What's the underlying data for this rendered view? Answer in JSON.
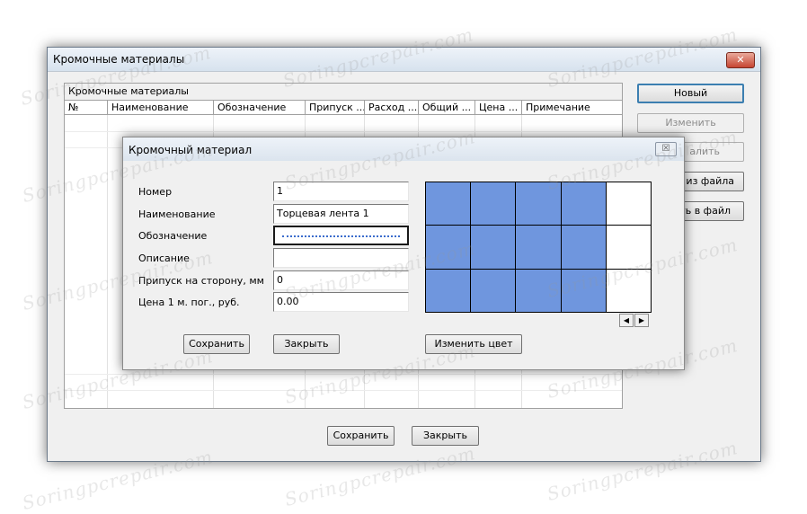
{
  "main_window": {
    "title": "Кромочные материалы",
    "close_glyph": "✕",
    "group_label": "Кромочные материалы",
    "columns": [
      "№",
      "Наименование",
      "Обозначение",
      "Припуск ...",
      "Расход ...",
      "Общий ...",
      "Цена ...",
      "Примечание"
    ],
    "buttons": {
      "new": "Новый",
      "edit": "Изменить",
      "delete": "алить",
      "load_from_file": "ь из файла",
      "save_to_file": "ить в файл",
      "save": "Сохранить",
      "close": "Закрыть"
    }
  },
  "dialog": {
    "title": "Кромочный материал",
    "close_glyph": "☒",
    "fields": {
      "number": {
        "label": "Номер",
        "value": "1"
      },
      "name": {
        "label": "Наименование",
        "value": "Торцевая лента 1"
      },
      "designation": {
        "label": "Обозначение",
        "value": ""
      },
      "description": {
        "label": "Описание",
        "value": ""
      },
      "allowance": {
        "label": "Припуск на сторону, мм",
        "value": "0"
      },
      "price": {
        "label": "Цена 1 м. пог., руб.",
        "value": "0.00"
      }
    },
    "buttons": {
      "save": "Сохранить",
      "close": "Закрыть",
      "change_color": "Изменить цвет"
    },
    "scroll_left": "◀",
    "scroll_right": "▶",
    "swatch_color": "#6f96de"
  },
  "watermark": "Soringpcrepair.com"
}
